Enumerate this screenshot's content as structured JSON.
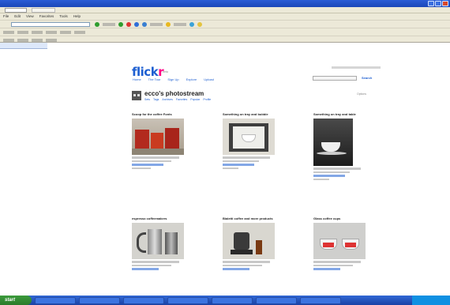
{
  "browser": {
    "title": "",
    "menu": [
      "File",
      "Edit",
      "View",
      "Favorites",
      "Tools",
      "Help"
    ]
  },
  "flickr": {
    "logo_main": "flick",
    "logo_r": "r",
    "logo_sub": "beta",
    "nav": [
      "Home",
      "The Tour",
      "Sign Up",
      "Explore",
      "Upload"
    ],
    "search_button": "Search",
    "photostream_title": "ecco's photostream",
    "photostream_links": [
      "Sets",
      "Tags",
      "Archives",
      "Favorites",
      "Popular",
      "Profile"
    ],
    "options_label": "Options"
  },
  "sets": [
    {
      "title": "Scoop for the coffee Fonts"
    },
    {
      "title": "Something on tray and bubble"
    },
    {
      "title": "Something on tray and table"
    },
    {
      "title": "espresso coffeemakers"
    },
    {
      "title": "Bialetti coffee and more products"
    },
    {
      "title": "Glass coffee cups"
    }
  ],
  "taskbar": {
    "start_label": "start"
  }
}
